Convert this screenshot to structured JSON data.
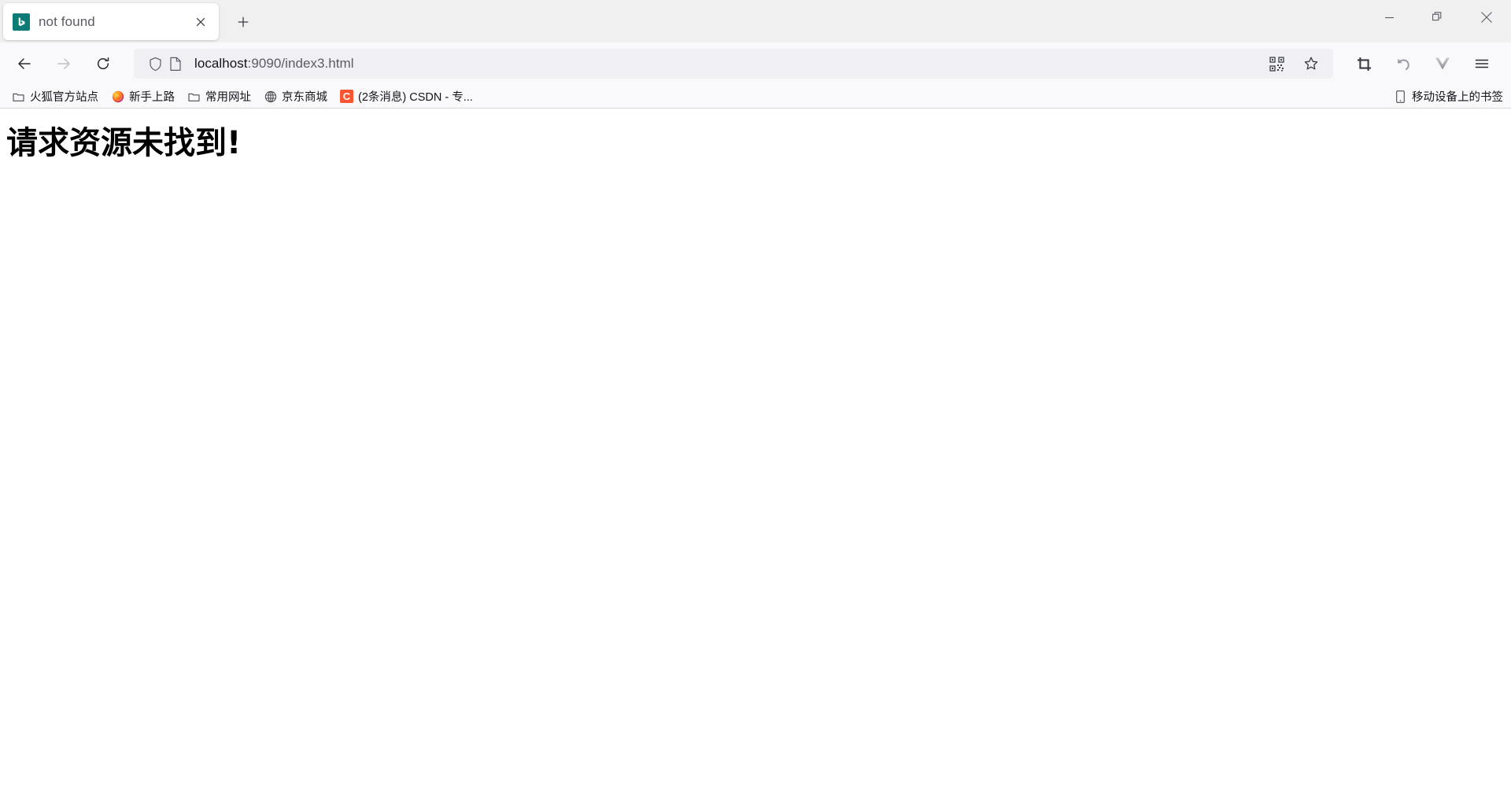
{
  "window": {
    "controls": [
      {
        "name": "minimize",
        "glyph": "minimize-icon"
      },
      {
        "name": "restore",
        "glyph": "restore-icon"
      },
      {
        "name": "close",
        "glyph": "close-icon"
      }
    ]
  },
  "tabstrip": {
    "tabs": [
      {
        "title": "not found",
        "favicon": "bing-b-favicon",
        "favicon_color": "#0d7c76",
        "active": true
      }
    ],
    "close_tab_label": "×",
    "new_tab_label": "+"
  },
  "toolbar": {
    "back": "back-arrow-icon",
    "forward": "forward-arrow-icon",
    "reload": "reload-icon",
    "screenshot": "crop-screenshot-icon",
    "undo": "undo-arrow-icon",
    "vue_devtools": "vue-devtools-icon",
    "menu": "hamburger-menu-icon"
  },
  "urlbar": {
    "shield_icon": "shield-icon",
    "page_icon": "page-document-icon",
    "url_host": "localhost",
    "url_path": ":9090/index3.html",
    "full_url": "localhost:9090/index3.html",
    "qr_icon": "qr-code-icon",
    "bookmark_star_icon": "star-outline-icon"
  },
  "bookmarks": {
    "items": [
      {
        "label": "火狐官方站点",
        "icon": "folder-icon"
      },
      {
        "label": "新手上路",
        "icon": "firefox-icon"
      },
      {
        "label": "常用网址",
        "icon": "folder-icon"
      },
      {
        "label": "京东商城",
        "icon": "globe-icon"
      },
      {
        "label": "(2条消息) CSDN - 专...",
        "icon": "csdn-icon",
        "icon_letter": "C",
        "icon_color": "#fc5531"
      }
    ],
    "mobile_bookmarks": {
      "label": "移动设备上的书签",
      "icon": "mobile-device-icon"
    }
  },
  "page": {
    "heading": "请求资源未找到!"
  },
  "colors": {
    "tabstrip_bg": "#f0f0f0",
    "toolbar_bg": "#f9f9fb",
    "urlbar_bg": "#f0f0f4",
    "content_bg": "#ffffff",
    "favicon_teal": "#0d7c76",
    "csdn_red": "#fc5531"
  }
}
